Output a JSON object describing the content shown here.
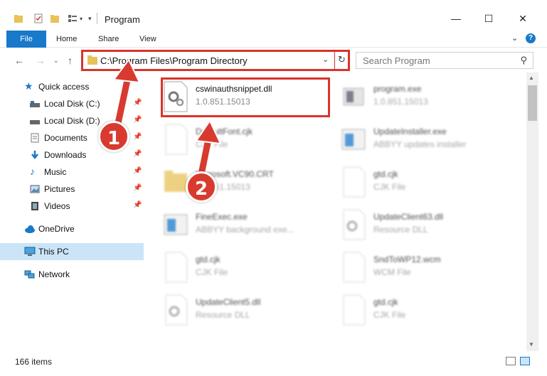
{
  "window": {
    "title": "Program",
    "minimize_icon": "minimize-icon",
    "maximize_icon": "maximize-icon",
    "close_icon": "close-icon"
  },
  "ribbon": {
    "tabs": [
      {
        "label": "File"
      },
      {
        "label": "Home"
      },
      {
        "label": "Share"
      },
      {
        "label": "View"
      }
    ]
  },
  "navbar": {
    "address": "C:\\Program Files\\Program Directory",
    "search_placeholder": "Search Program"
  },
  "sidebar": {
    "items": [
      {
        "label": "Quick access",
        "icon": "star-icon"
      },
      {
        "label": "Local Disk (C:)",
        "icon": "drive-icon",
        "pinned": true
      },
      {
        "label": "Local Disk (D:)",
        "icon": "drive-icon",
        "pinned": true
      },
      {
        "label": "Documents",
        "icon": "documents-icon",
        "pinned": true
      },
      {
        "label": "Downloads",
        "icon": "download-icon",
        "pinned": true
      },
      {
        "label": "Music",
        "icon": "music-icon",
        "pinned": true
      },
      {
        "label": "Pictures",
        "icon": "pictures-icon",
        "pinned": true
      },
      {
        "label": "Videos",
        "icon": "videos-icon",
        "pinned": true
      },
      {
        "label": "OneDrive",
        "icon": "cloud-icon"
      },
      {
        "label": "This PC",
        "icon": "computer-icon",
        "selected": true
      },
      {
        "label": "Network",
        "icon": "network-icon"
      }
    ]
  },
  "files": [
    {
      "name": "cswinauthsnippet.dll",
      "sub": "1.0.851.15013",
      "icon": "dll-icon",
      "clear": true
    },
    {
      "name": "program.exe",
      "sub": "1.0.851.15013",
      "icon": "exe-icon"
    },
    {
      "name": "DefaultFont.cjk",
      "sub": "CJK File",
      "icon": "file-icon"
    },
    {
      "name": "UpdateInstaller.exe",
      "sub": "ABBYY updates installer",
      "icon": "exe-icon"
    },
    {
      "name": "Microsoft.VC90.CRT",
      "sub": "1.0.851.15013",
      "icon": "folder-icon"
    },
    {
      "name": "gtd.cjk",
      "sub": "CJK File",
      "icon": "file-icon"
    },
    {
      "name": "FineExec.exe",
      "sub": "ABBYY background exe...",
      "icon": "exe-icon"
    },
    {
      "name": "UpdateClient63.dll",
      "sub": "Resource DLL",
      "icon": "dll-icon"
    },
    {
      "name": "gtd.cjk",
      "sub": "CJK File",
      "icon": "file-icon"
    },
    {
      "name": "SndToWP12.wcm",
      "sub": "WCM File",
      "icon": "file-icon"
    },
    {
      "name": "UpdateClient5.dll",
      "sub": "Resource DLL",
      "icon": "dll-icon"
    },
    {
      "name": "gtd.cjk",
      "sub": "CJK File",
      "icon": "file-icon"
    }
  ],
  "status": {
    "item_count": "166 items"
  },
  "markers": {
    "one": "1",
    "two": "2"
  },
  "colors": {
    "accent": "#1979ca",
    "highlight": "#d9342b",
    "selected": "#cce4f7"
  }
}
